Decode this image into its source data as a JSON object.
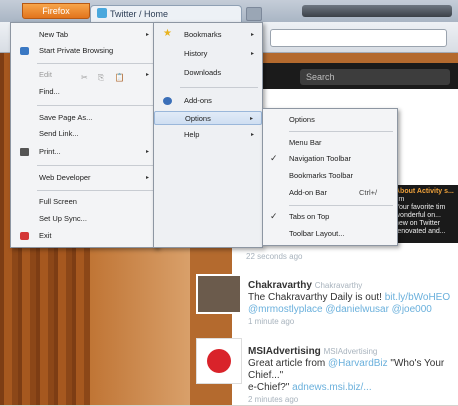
{
  "window": {
    "firefox_button": "Firefox",
    "tab_title": "Twitter / Home"
  },
  "twitter": {
    "search_placeholder": "Search",
    "sidebar_box": [
      "About Activity s...",
      "tim",
      "Your favorite tim",
      "wonderful on...",
      "new on Twitter",
      "renovated and..."
    ],
    "top_time": "22 seconds ago",
    "tweets": [
      {
        "name": "Chakravarthy",
        "handle": "Chakravarthy",
        "text_before": "The Chakravarthy Daily is out!",
        "link": "bit.ly/bWoHEO",
        "mentions": "@mrmostlyplace @danielwusar @joe000",
        "time": "1 minute ago"
      },
      {
        "name": "MSIAdvertising",
        "handle": "MSIAdvertising",
        "text_before": "Great article from",
        "link": "@HarvardBiz",
        "text_after": "\"Who's Your Chief...\"",
        "line2_text": "e-Chief?\"",
        "line2_link": "adnews.msi.biz/...",
        "time": "2 minutes ago"
      }
    ]
  },
  "menu_main": {
    "items": [
      {
        "label": "New Tab",
        "arrow": "▸",
        "icon": "none"
      },
      {
        "label": "Start Private Browsing",
        "icon": "private-browsing-icon"
      },
      {
        "label": "Edit",
        "arrow": "▸",
        "disabled": true,
        "icons": "✂ ⎘ 📋"
      },
      {
        "label": "Find..."
      },
      {
        "label": "Save Page As..."
      },
      {
        "label": "Send Link..."
      },
      {
        "label": "Print...",
        "arrow": "▸",
        "icon": "printer-icon"
      },
      {
        "label": "Web Developer",
        "arrow": "▸"
      },
      {
        "label": "Full Screen"
      },
      {
        "label": "Set Up Sync..."
      },
      {
        "label": "Exit",
        "icon": "exit-icon"
      }
    ]
  },
  "menu_bookmarks_col": {
    "items": [
      {
        "label": "Bookmarks",
        "arrow": "▸"
      },
      {
        "label": "History",
        "arrow": "▸"
      },
      {
        "label": "Downloads"
      },
      {
        "label": "Add-ons"
      },
      {
        "label": "Options",
        "arrow": "▸"
      },
      {
        "label": "Help",
        "arrow": "▸"
      }
    ]
  },
  "menu_options": {
    "items": [
      {
        "label": "Options"
      },
      {
        "label": "Menu Bar",
        "checked": false
      },
      {
        "label": "Navigation Toolbar",
        "checked": true
      },
      {
        "label": "Bookmarks Toolbar",
        "checked": false
      },
      {
        "label": "Add-on Bar",
        "shortcut": "Ctrl+/",
        "checked": false
      },
      {
        "label": "Tabs on Top",
        "checked": true
      },
      {
        "label": "Toolbar Layout..."
      }
    ]
  }
}
